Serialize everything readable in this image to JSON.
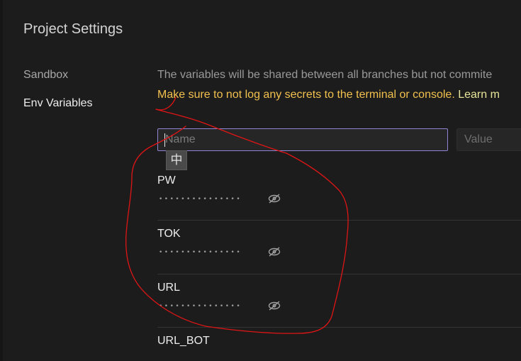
{
  "page": {
    "title": "Project Settings"
  },
  "nav": {
    "items": [
      {
        "label": "Sandbox",
        "active": false
      },
      {
        "label": "Env Variables",
        "active": true
      }
    ]
  },
  "env": {
    "description": "The variables will be shared between all branches but not commite",
    "warning": "Make sure to not log any secrets to the terminal or console.",
    "learn_more": "Learn m",
    "name_placeholder": "Name",
    "value_placeholder": "Value",
    "ime_indicator": "中",
    "variables": [
      {
        "key": "PW",
        "masked": "•••••••••••••••"
      },
      {
        "key": "TOK",
        "masked": "•••••••••••••••"
      },
      {
        "key": "URL",
        "masked": "•••••••••••••••"
      },
      {
        "key": "URL_BOT"
      }
    ]
  },
  "colors": {
    "background": "#1c1c1c",
    "warning": "#f2c14e",
    "focus_border": "#8f84d6",
    "annotation": "#e01515"
  },
  "icons": {
    "reveal": "eye-off-icon"
  }
}
